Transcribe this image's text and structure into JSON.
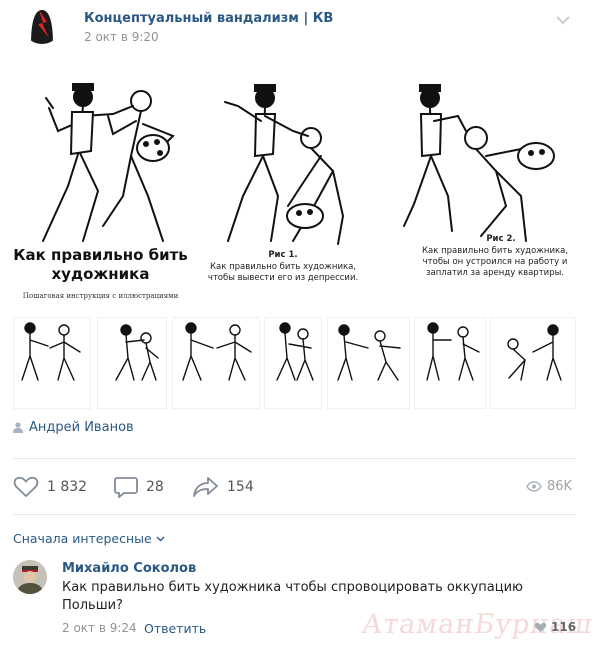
{
  "post": {
    "group_name": "Концептуальный вандализм | КВ",
    "time": "2 окт в 9:20",
    "author": "Андрей Иванов"
  },
  "images": {
    "main_title": "Как правильно бить художника",
    "main_subtitle": "Пошаговая инструкция с иллюстрациями",
    "fig1_label": "Рис 1.",
    "fig1_caption": "Как правильно бить художника, чтобы вывести его из депрессии.",
    "fig2_label": "Рис 2.",
    "fig2_caption": "Как правильно бить художника, чтобы он устроился на работу и заплатил за аренду квартиры."
  },
  "actions": {
    "likes": "1 832",
    "comments": "28",
    "shares": "154",
    "views": "86K"
  },
  "comments": {
    "sort_label": "Сначала интересные",
    "items": [
      {
        "author": "Михайло Соколов",
        "text": "Как правильно бить художника чтобы спровоцировать оккупацию Польши?",
        "time": "2 окт в 9:24",
        "reply_label": "Ответить",
        "likes": "116"
      }
    ]
  },
  "watermark": "АтаманБурнаш ѧнп.пп",
  "icons": {
    "more": "chevron-down-icon",
    "author": "person-icon",
    "like": "heart-icon",
    "comment": "comment-bubble-icon",
    "share": "share-arrow-icon",
    "views": "eye-icon",
    "sort": "chevron-down-icon",
    "comment_like": "heart-icon"
  },
  "colors": {
    "link": "#2a5885",
    "muted": "#939393",
    "divider": "#e7e8ec"
  }
}
